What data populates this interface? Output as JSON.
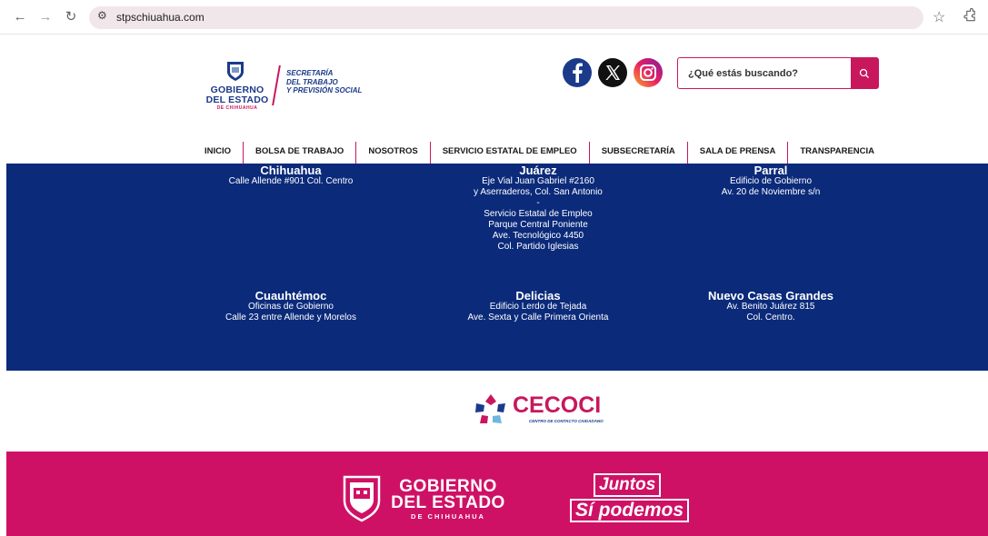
{
  "browser": {
    "url": "stpschiuahua.com",
    "back_icon": "arrow-left-icon",
    "forward_icon": "arrow-right-icon",
    "reload_icon": "reload-icon"
  },
  "header": {
    "logo_gob_line1": "GOBIERNO",
    "logo_gob_line2": "DEL ESTADO",
    "logo_gob_line3": "DE CHIHUAHUA",
    "logo_sec_line1": "SECRETARÍA",
    "logo_sec_line2": "DEL TRABAJO",
    "logo_sec_line3": "Y PREVISIÓN SOCIAL",
    "search_placeholder": "¿Qué estás buscando?"
  },
  "nav": {
    "items": [
      {
        "label": "INICIO"
      },
      {
        "label": "BOLSA DE TRABAJO"
      },
      {
        "label": "NOSOTROS"
      },
      {
        "label": "SERVICIO ESTATAL DE EMPLEO"
      },
      {
        "label": "SUBSECRETARÍA"
      },
      {
        "label": "SALA DE PRENSA"
      },
      {
        "label": "TRANSPARENCIA"
      }
    ]
  },
  "offices": [
    {
      "city": "Chihuahua",
      "lines": [
        "Calle Allende #901 Col. Centro"
      ]
    },
    {
      "city": "Juárez",
      "lines": [
        "Eje Vial Juan Gabriel #2160",
        "y Aserraderos, Col. San Antonio",
        "-",
        "Servicio Estatal de Empleo",
        "Parque Central Poniente",
        "Ave. Tecnológico 4450",
        "Col. Partido Iglesias"
      ]
    },
    {
      "city": "Parral",
      "lines": [
        "Edificio de Gobierno",
        "Av. 20 de Noviembre s/n"
      ]
    },
    {
      "city": "Cuauhtémoc",
      "lines": [
        "Oficinas de Gobierno",
        "Calle 23 entre Allende y Morelos"
      ]
    },
    {
      "city": "Delicias",
      "lines": [
        "Edificio Lerdo de Tejada",
        "Ave. Sexta y Calle Primera Orienta"
      ]
    },
    {
      "city": "Nuevo Casas Grandes",
      "lines": [
        "Av. Benito Juárez 815",
        "Col. Centro."
      ]
    }
  ],
  "cecoci": {
    "title": "CECOCI",
    "subtitle": "CENTRO DE CONTACTO CIUDADANO"
  },
  "footer": {
    "gob_line1": "GOBIERNO",
    "gob_line2": "DEL ESTADO",
    "gob_line3": "DE CHIHUAHUA",
    "slogan_line1": "Juntos",
    "slogan_line2": "Sí podemos"
  },
  "colors": {
    "brand_blue": "#0b2a7a",
    "brand_pink": "#cf1166"
  }
}
